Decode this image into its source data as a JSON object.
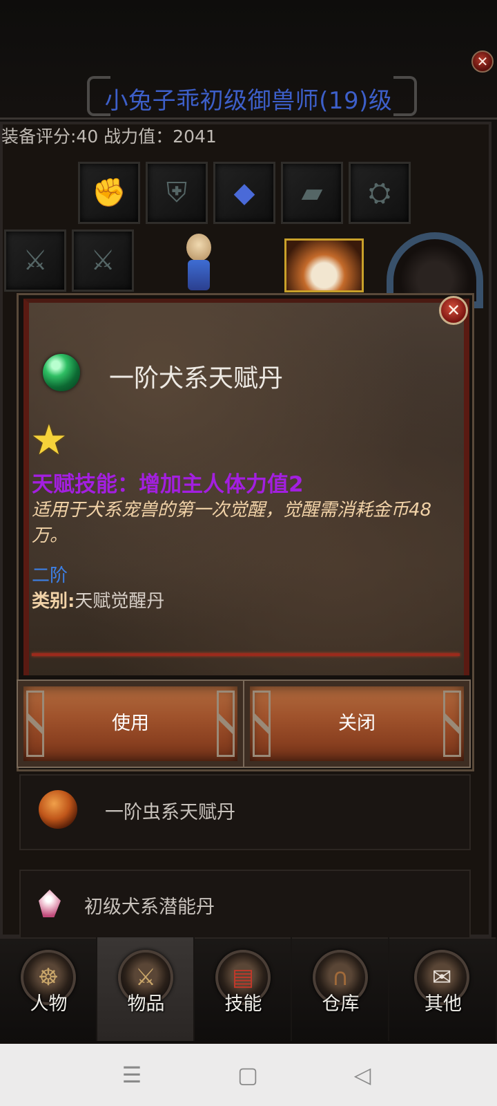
{
  "header": {
    "character_title": "小兔子乖初级御兽师(19)级",
    "score_line": "装备评分:40 战力值：2041"
  },
  "equipment": {
    "slot_icons": [
      "gloves-icon",
      "armor-icon",
      "amulet-icon",
      "bracer-icon",
      "boots-icon",
      "sword-icon",
      "sword-icon"
    ]
  },
  "dialog": {
    "item_name": "一阶犬系天赋丹",
    "talent_line": "天赋技能：增加主人体力值2",
    "description": "适用于犬系宠兽的第一次觉醒，觉醒需消耗金币48万。",
    "tier": "二阶",
    "category_key": "类别:",
    "category_value": "天赋觉醒丹",
    "buttons": {
      "use": "使用",
      "close": "关闭"
    },
    "colors": {
      "talent": "#a31fe0",
      "description": "#f2d3a8",
      "tier": "#3d80e6"
    }
  },
  "item_list": [
    {
      "name": "一阶虫系天赋丹",
      "icon": "orange-orb-icon"
    },
    {
      "name": "初级犬系潜能丹",
      "icon": "pink-crystal-icon"
    }
  ],
  "tabs": [
    {
      "label": "人物",
      "icon": "character-icon",
      "active": false
    },
    {
      "label": "物品",
      "icon": "crossed-swords-icon",
      "active": true
    },
    {
      "label": "技能",
      "icon": "skill-book-icon",
      "active": false
    },
    {
      "label": "仓库",
      "icon": "door-icon",
      "active": false
    },
    {
      "label": "其他",
      "icon": "scroll-icon",
      "active": false
    }
  ],
  "system_nav": {
    "menu": "☰",
    "home": "▢",
    "back": "◁"
  }
}
